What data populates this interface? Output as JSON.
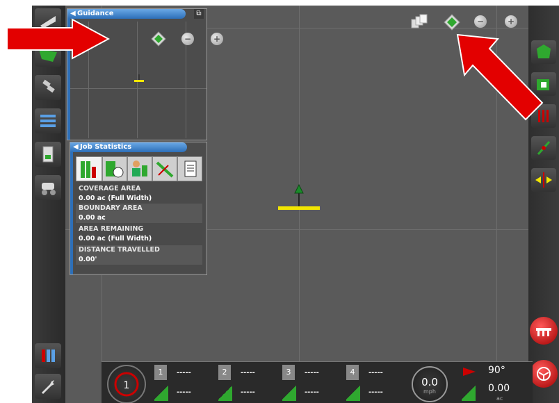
{
  "guidance_panel": {
    "title": "Guidance"
  },
  "job_stats": {
    "title": "Job Statistics",
    "rows": [
      {
        "label": "COVERAGE AREA",
        "value": "0.00 ac (Full Width)"
      },
      {
        "label": "BOUNDARY AREA",
        "value": "0.00 ac"
      },
      {
        "label": "AREA REMAINING",
        "value": "0.00 ac (Full Width)"
      },
      {
        "label": "DISTANCE TRAVELLED",
        "value": "0.00'"
      }
    ]
  },
  "bottom_bar": {
    "sections": [
      {
        "num": "1",
        "top": "-----",
        "bottom": "-----"
      },
      {
        "num": "2",
        "top": "-----",
        "bottom": "-----"
      },
      {
        "num": "3",
        "top": "-----",
        "bottom": "-----"
      },
      {
        "num": "4",
        "top": "-----",
        "bottom": "-----"
      }
    ],
    "speed": {
      "value": "0.0",
      "unit": "mph"
    },
    "heading": "90°",
    "area": {
      "value": "0.00",
      "unit": "ac"
    }
  },
  "colors": {
    "accent": "#2d6fb8",
    "guidance_line": "#f2e600",
    "red_arrow": "#e30000",
    "section_green": "#2fa82f"
  }
}
